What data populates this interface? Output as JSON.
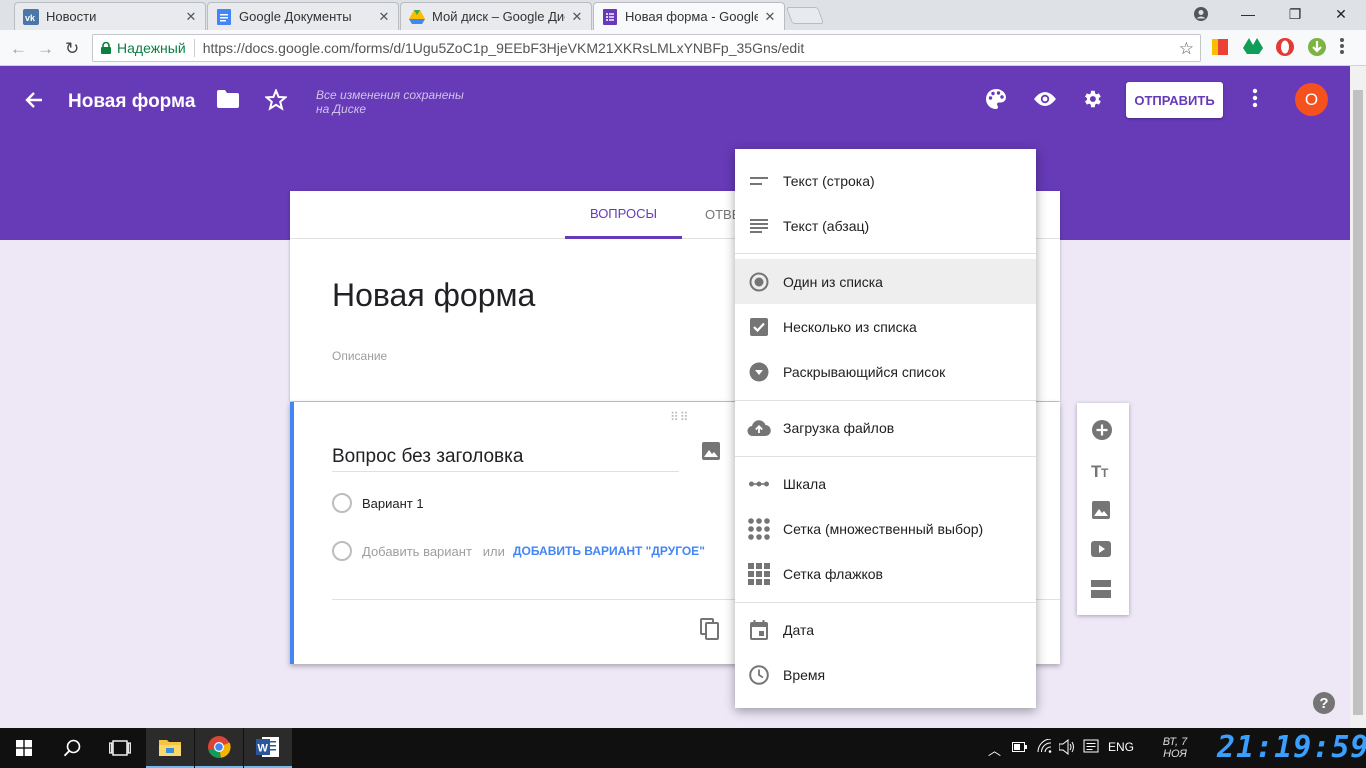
{
  "browser": {
    "tabs": [
      {
        "title": "Новости",
        "icon": "vk-icon"
      },
      {
        "title": "Google Документы",
        "icon": "docs-icon"
      },
      {
        "title": "Мой диск – Google Дис",
        "icon": "drive-icon"
      },
      {
        "title": "Новая форма - Google",
        "icon": "forms-icon"
      }
    ],
    "secure_label": "Надежный",
    "url": "https://docs.google.com/forms/d/1Ugu5ZoC1p_9EEbF3HjeVKM21XKRsLMLxYNBFp_35Gns/edit"
  },
  "header": {
    "title": "Новая форма",
    "saved_status_line1": "Все изменения сохранены",
    "saved_status_line2": "на Диске",
    "send_label": "ОТПРАВИТЬ",
    "avatar_letter": "O",
    "bg_color": "#673ab7"
  },
  "tabs": {
    "questions": "ВОПРОСЫ",
    "answers": "ОТВЕ"
  },
  "form": {
    "title": "Новая форма",
    "description_placeholder": "Описание"
  },
  "question": {
    "title": "Вопрос без заголовка",
    "option1": "Вариант 1",
    "add_option": "Добавить вариант",
    "or": "или",
    "add_other": "ДОБАВИТЬ ВАРИАНТ \"ДРУГОЕ\""
  },
  "menu": {
    "items": [
      {
        "label": "Текст (строка)",
        "icon": "short-text-icon"
      },
      {
        "label": "Текст (абзац)",
        "icon": "paragraph-icon"
      },
      {
        "label": "Один из списка",
        "icon": "radio-icon",
        "selected": true
      },
      {
        "label": "Несколько из списка",
        "icon": "checkbox-icon"
      },
      {
        "label": "Раскрывающийся список",
        "icon": "dropdown-icon"
      },
      {
        "label": "Загрузка файлов",
        "icon": "cloud-upload-icon"
      },
      {
        "label": "Шкала",
        "icon": "scale-icon"
      },
      {
        "label": "Сетка (множественный выбор)",
        "icon": "grid-dots-icon"
      },
      {
        "label": "Сетка флажков",
        "icon": "grid-squares-icon"
      },
      {
        "label": "Дата",
        "icon": "calendar-icon"
      },
      {
        "label": "Время",
        "icon": "clock-icon"
      }
    ]
  },
  "taskbar": {
    "lang": "ENG",
    "day": "ВТ, 7",
    "month": "НОЯ",
    "time": "21:19:59"
  }
}
